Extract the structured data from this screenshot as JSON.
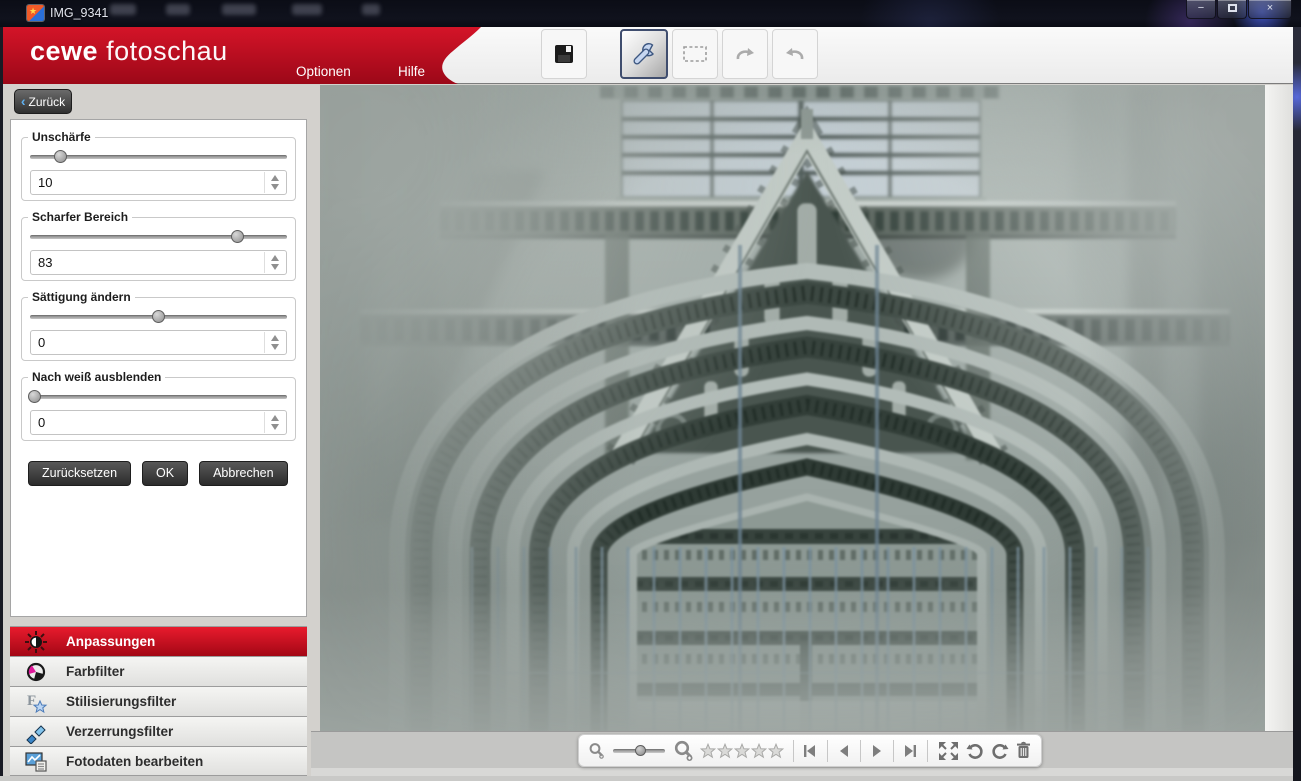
{
  "window": {
    "title": "IMG_9341",
    "controls": {
      "minimize": "−",
      "maximize": "maximize",
      "close": "×"
    }
  },
  "header": {
    "brand_bold": "cewe",
    "brand_light": "fotoschau",
    "brand_red": "#c60d1f",
    "menu_optionen": "Optionen",
    "menu_hilfe": "Hilfe"
  },
  "toolbar": {
    "buttons": [
      {
        "name": "save-button",
        "icon": "floppy-disk-icon",
        "active": false
      },
      {
        "name": "adjustments-button",
        "icon": "wrench-icon",
        "active": true
      },
      {
        "name": "crop-button",
        "icon": "selection-rectangle-icon",
        "active": false
      },
      {
        "name": "undo-button",
        "icon": "undo-arrow-icon",
        "active": false
      },
      {
        "name": "redo-button",
        "icon": "redo-arrow-icon",
        "active": false
      }
    ]
  },
  "sidebar": {
    "back_label": "Zurück",
    "groups": [
      {
        "label": "Unschärfe",
        "value": "10",
        "slider_percent": 12
      },
      {
        "label": "Scharfer Bereich",
        "value": "83",
        "slider_percent": 81
      },
      {
        "label": "Sättigung ändern",
        "value": "0",
        "slider_percent": 50
      },
      {
        "label": "Nach weiß ausblenden",
        "value": "0",
        "slider_percent": 2
      }
    ],
    "reset_label": "Zurücksetzen",
    "ok_label": "OK",
    "cancel_label": "Abbrechen",
    "selected_color": "#c8102a",
    "categories": [
      {
        "label": "Anpassungen",
        "icon": "brightness-icon",
        "selected": true
      },
      {
        "label": "Farbfilter",
        "icon": "color-filter-icon",
        "selected": false
      },
      {
        "label": "Stilisierungsfilter",
        "icon": "stylize-filter-icon",
        "selected": false
      },
      {
        "label": "Verzerrungsfilter",
        "icon": "distortion-filter-icon",
        "selected": false
      },
      {
        "label": "Fotodaten bearbeiten",
        "icon": "photo-data-icon",
        "selected": false
      }
    ]
  },
  "viewer": {
    "photo_description": "Gothic cathedral portal with blurred-edge filter preview",
    "zoom_slider_percent": 55,
    "rating": {
      "stars_total": 5,
      "stars_filled": 0
    },
    "tools": [
      "zoom-out",
      "zoom-slider",
      "zoom-in",
      "rating-stars",
      "first-photo",
      "previous-photo",
      "next-photo",
      "last-photo",
      "fullscreen",
      "rotate-left",
      "rotate-right",
      "delete"
    ]
  }
}
